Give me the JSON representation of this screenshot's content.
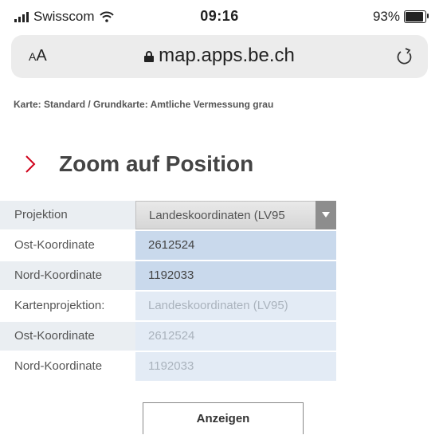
{
  "status": {
    "carrier": "Swisscom",
    "time": "09:16",
    "battery": "93%",
    "battery_level": 0.93
  },
  "browser": {
    "text_size_label_small": "A",
    "text_size_label_large": "A",
    "url": "map.apps.be.ch"
  },
  "map_info": "Karte: Standard / Grundkarte: Amtliche Vermessung grau",
  "section": {
    "title": "Zoom auf Position",
    "accent_color": "#d0021b"
  },
  "form": {
    "projection_label": "Projektion",
    "projection_value": "Landeskoordinaten (LV95",
    "east_label": "Ost-Koordinate",
    "east_value": "2612524",
    "north_label": "Nord-Koordinate",
    "north_value": "1192033",
    "map_projection_label": "Kartenprojektion:",
    "map_projection_value": "Landeskoordinaten (LV95)",
    "map_east_label": "Ost-Koordinate",
    "map_east_value": "2612524",
    "map_north_label": "Nord-Koordinate",
    "map_north_value": "1192033"
  },
  "show_button_label": "Anzeigen"
}
